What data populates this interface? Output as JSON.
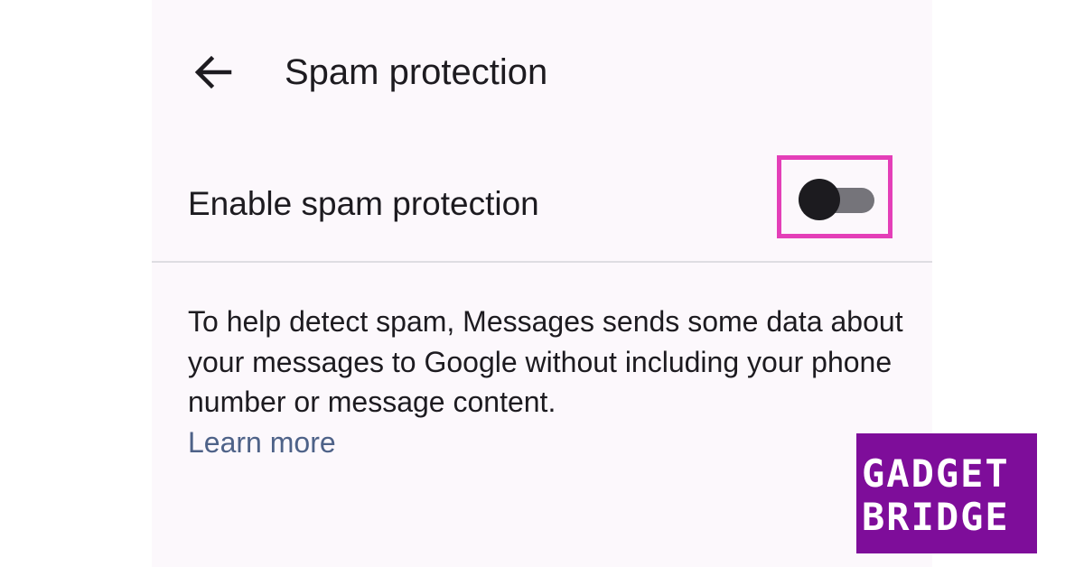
{
  "header": {
    "back_icon": "arrow-left-icon",
    "title": "Spam protection"
  },
  "setting": {
    "label": "Enable spam protection",
    "toggle_state": "off",
    "highlight_color": "#e43fb8"
  },
  "description": {
    "text": "To help detect spam, Messages sends some data about your messages to Google without including your phone number or message content.",
    "link_label": "Learn more",
    "link_color": "#4e6288"
  },
  "watermark": {
    "line1": "GADGET",
    "line2": "BRIDGE",
    "background": "#7e0d9a"
  }
}
